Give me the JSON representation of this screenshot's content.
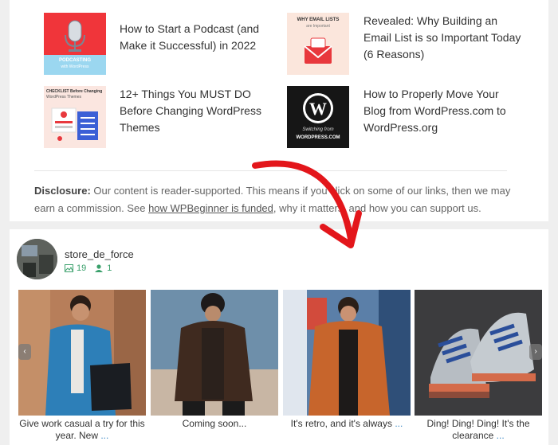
{
  "posts": [
    {
      "title": "How to Start a Podcast (and Make it Successful) in 2022",
      "thumb_text": [
        "PODCASTING",
        "with WordPress"
      ]
    },
    {
      "title": "Revealed: Why Building an Email List is so Important Today (6 Reasons)",
      "thumb_text": [
        "WHY EMAIL LISTS",
        "are Important"
      ]
    },
    {
      "title": "12+ Things You MUST DO Before Changing WordPress Themes",
      "thumb_text": [
        "CHECKLIST Before Changing",
        "WordPress Themes"
      ]
    },
    {
      "title": "How to Properly Move Your Blog from WordPress.com to WordPress.org",
      "thumb_text": [
        "Switching from",
        "WORDPRESS.COM"
      ]
    }
  ],
  "disclosure": {
    "label": "Disclosure:",
    "text_1": " Our content is reader-supported. This means if you click on some of our links, then we may earn a commission. See ",
    "link": "how WPBeginner is funded",
    "text_2": ", why it matters, and how you can support us."
  },
  "feed": {
    "username": "store_de_force",
    "posts_count": "19",
    "followers_count": "1",
    "items": [
      {
        "caption": "Give work casual a try for this year. New ",
        "more": "..."
      },
      {
        "caption": "Coming soon...",
        "more": ""
      },
      {
        "caption": "It's retro, and it's always ",
        "more": "..."
      },
      {
        "caption": "Ding! Ding! Ding! It's the clearance ",
        "more": "..."
      }
    ],
    "prev_label": "‹",
    "next_label": "›"
  },
  "colors": {
    "accent": "#3aa06b",
    "link": "#3a87c4",
    "annotation": "#e3161b"
  }
}
